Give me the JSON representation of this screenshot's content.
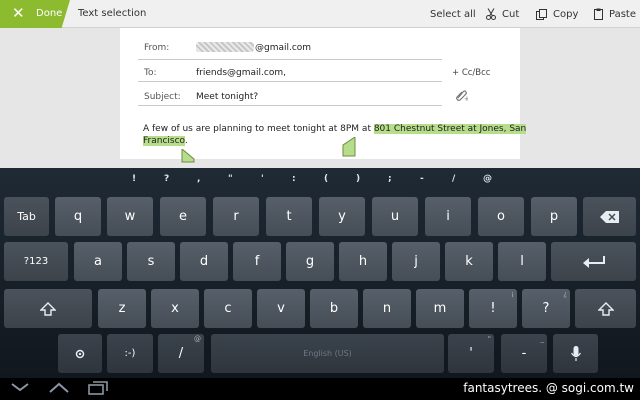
{
  "action_bar": {
    "done_label": "Done",
    "title": "Text selection",
    "select_all_label": "Select all",
    "cut_label": "Cut",
    "copy_label": "Copy",
    "paste_label": "Paste",
    "accent_color": "#8dbb2f"
  },
  "compose": {
    "from_label": "From:",
    "from_value": "@gmail.com",
    "to_label": "To:",
    "to_value": "friends@gmail.com,",
    "cc_bcc_label": "+ Cc/Bcc",
    "subject_label": "Subject:",
    "subject_value": "Meet tonight?",
    "body_plain": "A few of us are planning to meet tonight at 8PM at ",
    "body_selected_line1": "801 Chestnut Street at Jones, San",
    "body_selected_line2": "Francisco",
    "body_after": ".",
    "selection_color": "#b6dd8a"
  },
  "keyboard": {
    "symbols": [
      "!",
      "?",
      ",",
      "\"",
      "'",
      ":",
      "(",
      ")",
      ";",
      "-",
      "/",
      "@"
    ],
    "row1": [
      "q",
      "w",
      "e",
      "r",
      "t",
      "y",
      "u",
      "i",
      "o",
      "p"
    ],
    "row2": [
      "a",
      "s",
      "d",
      "f",
      "g",
      "h",
      "j",
      "k",
      "l"
    ],
    "row3": [
      "z",
      "x",
      "c",
      "v",
      "b",
      "n",
      "m",
      "!",
      "?"
    ],
    "row3_subs": [
      "",
      "",
      "",
      "",
      "",
      "",
      "",
      "",
      "¡",
      "¿"
    ],
    "tab_label": "Tab",
    "numbers_label": "?123",
    "smiley_label": ":-)",
    "slash_label": "/",
    "slash_sub": "@",
    "space_label": "English (US)",
    "apostrophe_label": "'",
    "apostrophe_sub": "\"",
    "dash_label": "-",
    "dash_sub": "_",
    "bang_sub": "¡",
    "question_sub": "¿"
  },
  "watermark": "fantasytrees. @ sogi.com.tw"
}
